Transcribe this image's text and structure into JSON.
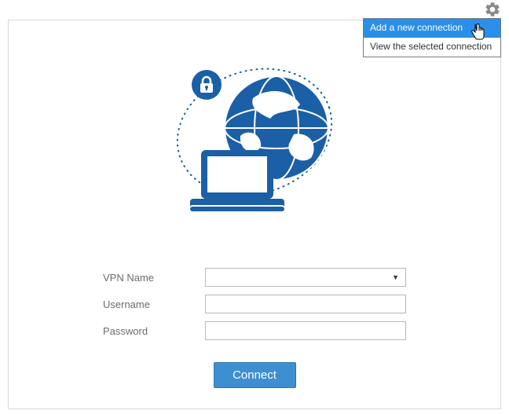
{
  "colors": {
    "brand": "#1b5fa6",
    "button": "#3d8fd1",
    "menuHighlight": "#2a8fea"
  },
  "settings_menu": {
    "items": [
      {
        "label": "Add a new connection",
        "highlighted": true
      },
      {
        "label": "View the selected connection",
        "highlighted": false
      }
    ]
  },
  "illustration": {
    "globe": "globe-icon",
    "laptop": "laptop-icon",
    "lock": "lock-icon"
  },
  "form": {
    "vpn_name": {
      "label": "VPN Name",
      "value": ""
    },
    "username": {
      "label": "Username",
      "value": ""
    },
    "password": {
      "label": "Password",
      "value": ""
    }
  },
  "actions": {
    "connect_label": "Connect"
  }
}
